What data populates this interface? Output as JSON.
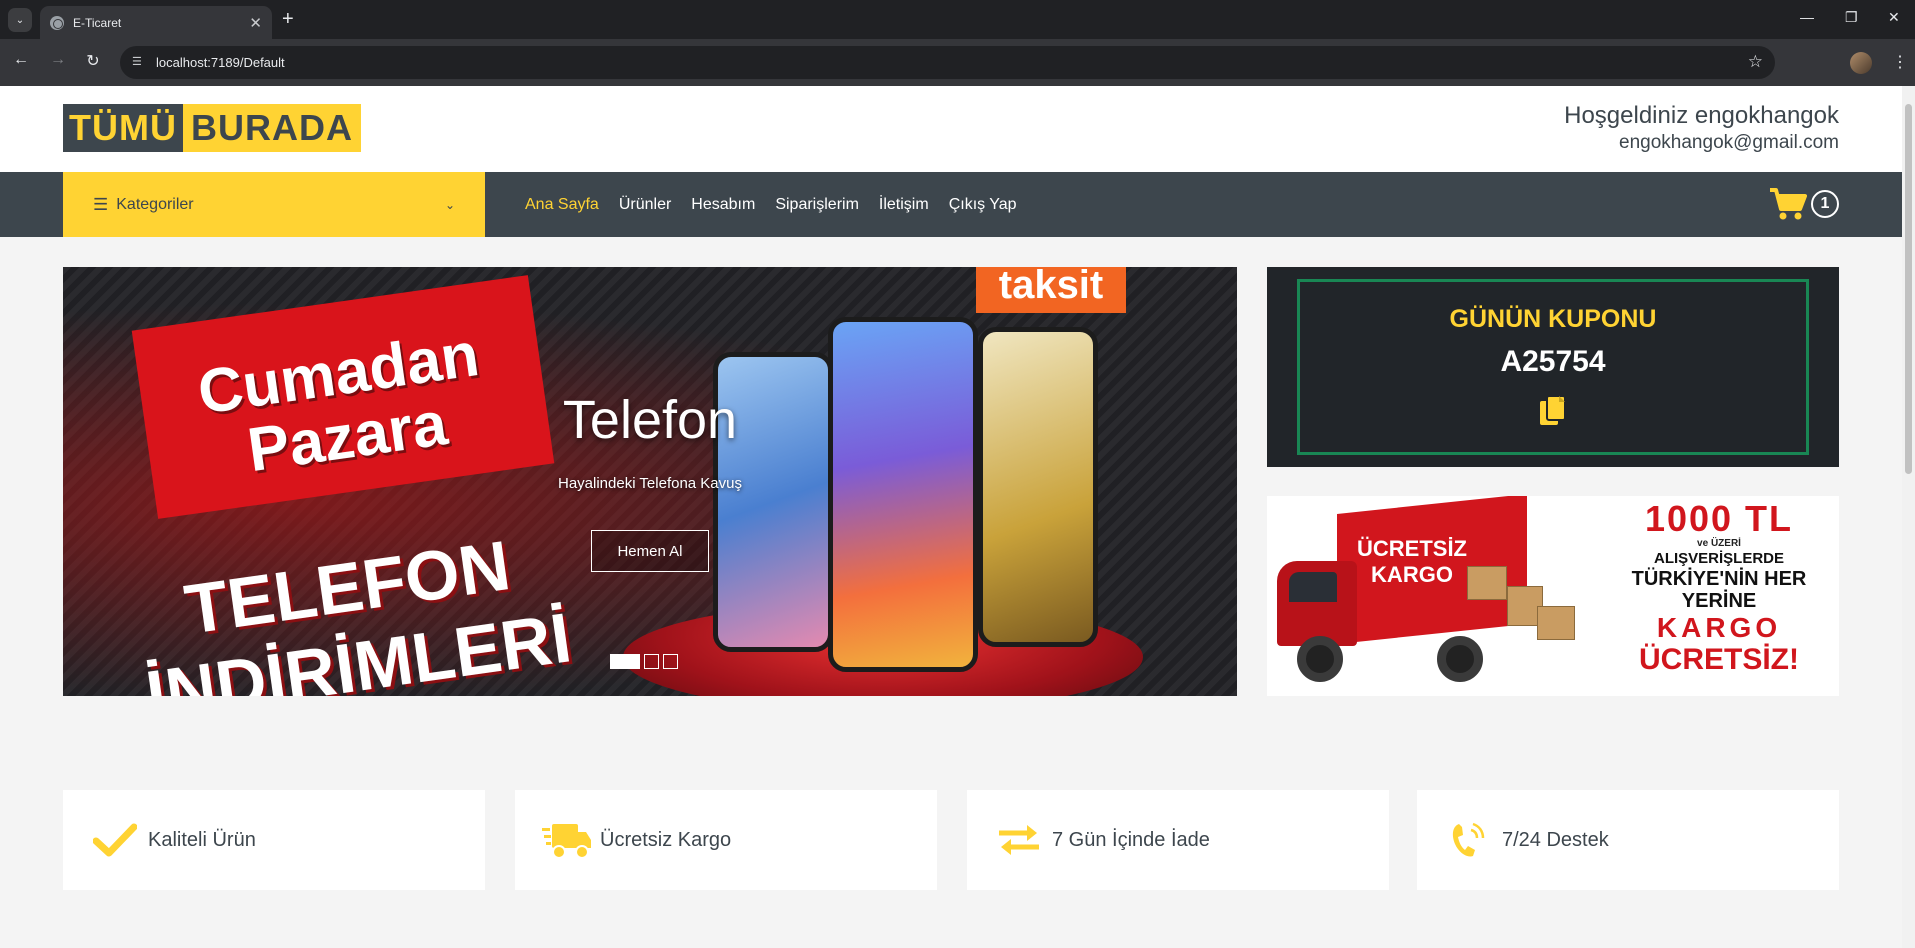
{
  "browser": {
    "tab_title": "E-Ticaret",
    "address": "localhost:7189/Default"
  },
  "header": {
    "logo_part1": "TÜMÜ",
    "logo_part2": "BURADA",
    "welcome_line": "Hoşgeldiniz engokhangok",
    "user_email": "engokhangok@gmail.com"
  },
  "navbar": {
    "categories_label": "Kategoriler",
    "menu": [
      {
        "label": "Ana Sayfa",
        "active": true
      },
      {
        "label": "Ürünler",
        "active": false
      },
      {
        "label": "Hesabım",
        "active": false
      },
      {
        "label": "Siparişlerim",
        "active": false
      },
      {
        "label": "İletişim",
        "active": false
      },
      {
        "label": "Çıkış Yap",
        "active": false
      }
    ],
    "cart_count": "1"
  },
  "carousel": {
    "image_text_top": "taksit",
    "image_text_banner": "Cumadan Pazara",
    "image_text_big": "TELEFON İNDİRİMLERİ",
    "slide_title": "Telefon",
    "slide_subtitle": "Hayalindeki Telefona Kavuş",
    "slide_button": "Hemen Al",
    "slide_count": 3,
    "active_slide": 1
  },
  "coupon": {
    "title": "GÜNÜN KUPONU",
    "code": "A25754"
  },
  "cargo_banner": {
    "truck_label": "ÜCRETSİZ KARGO",
    "line1": "1000 TL",
    "line2": "ve ÜZERİ",
    "line3": "ALIŞVERİŞLERDE",
    "line4": "TÜRKİYE'NİN HER YERİNE",
    "line5": "KARGO",
    "line6": "ÜCRETSİZ!"
  },
  "features": [
    {
      "label": "Kaliteli Ürün",
      "icon": "check-icon"
    },
    {
      "label": "Ücretsiz Kargo",
      "icon": "shipping-fast-icon"
    },
    {
      "label": "7 Gün İçinde İade",
      "icon": "exchange-icon"
    },
    {
      "label": "7/24 Destek",
      "icon": "phone-volume-icon"
    }
  ],
  "colors": {
    "brand_yellow": "#ffd333",
    "brand_dark": "#3d464d",
    "coupon_bg": "#212529",
    "coupon_border": "#198754"
  }
}
